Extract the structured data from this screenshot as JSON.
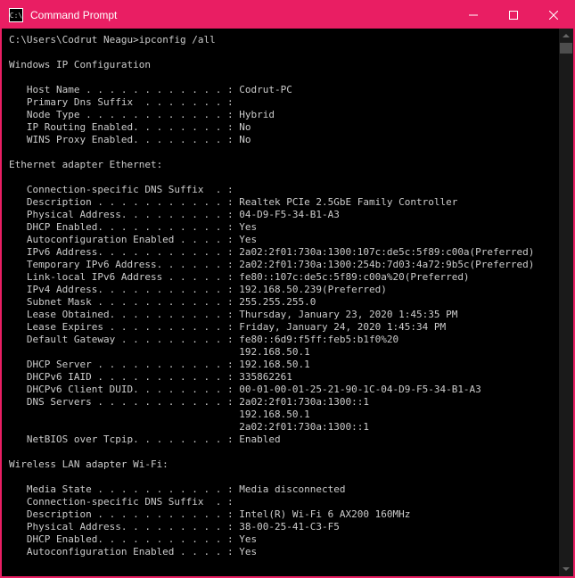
{
  "window": {
    "title": "Command Prompt",
    "icon_text": "C:\\"
  },
  "prompt": {
    "path": "C:\\Users\\Codrut Neagu>",
    "command": "ipconfig /all"
  },
  "sections": {
    "header": "Windows IP Configuration",
    "global": [
      {
        "label": "Host Name . . . . . . . . . . . . :",
        "value": " Codrut-PC"
      },
      {
        "label": "Primary Dns Suffix  . . . . . . . :",
        "value": ""
      },
      {
        "label": "Node Type . . . . . . . . . . . . :",
        "value": " Hybrid"
      },
      {
        "label": "IP Routing Enabled. . . . . . . . :",
        "value": " No"
      },
      {
        "label": "WINS Proxy Enabled. . . . . . . . :",
        "value": " No"
      }
    ],
    "eth_header": "Ethernet adapter Ethernet:",
    "ethernet": [
      {
        "label": "Connection-specific DNS Suffix  . :",
        "value": ""
      },
      {
        "label": "Description . . . . . . . . . . . :",
        "value": " Realtek PCIe 2.5GbE Family Controller"
      },
      {
        "label": "Physical Address. . . . . . . . . :",
        "value": " 04-D9-F5-34-B1-A3"
      },
      {
        "label": "DHCP Enabled. . . . . . . . . . . :",
        "value": " Yes"
      },
      {
        "label": "Autoconfiguration Enabled . . . . :",
        "value": " Yes"
      },
      {
        "label": "IPv6 Address. . . . . . . . . . . :",
        "value": " 2a02:2f01:730a:1300:107c:de5c:5f89:c00a(Preferred)"
      },
      {
        "label": "Temporary IPv6 Address. . . . . . :",
        "value": " 2a02:2f01:730a:1300:254b:7d03:4a72:9b5c(Preferred)"
      },
      {
        "label": "Link-local IPv6 Address . . . . . :",
        "value": " fe80::107c:de5c:5f89:c00a%20(Preferred)"
      },
      {
        "label": "IPv4 Address. . . . . . . . . . . :",
        "value": " 192.168.50.239(Preferred)"
      },
      {
        "label": "Subnet Mask . . . . . . . . . . . :",
        "value": " 255.255.255.0"
      },
      {
        "label": "Lease Obtained. . . . . . . . . . :",
        "value": " Thursday, January 23, 2020 1:45:35 PM"
      },
      {
        "label": "Lease Expires . . . . . . . . . . :",
        "value": " Friday, January 24, 2020 1:45:34 PM"
      },
      {
        "label": "Default Gateway . . . . . . . . . :",
        "value": " fe80::6d9:f5ff:feb5:b1f0%20"
      },
      {
        "label": "                                   ",
        "value": " 192.168.50.1"
      },
      {
        "label": "DHCP Server . . . . . . . . . . . :",
        "value": " 192.168.50.1"
      },
      {
        "label": "DHCPv6 IAID . . . . . . . . . . . :",
        "value": " 335862261"
      },
      {
        "label": "DHCPv6 Client DUID. . . . . . . . :",
        "value": " 00-01-00-01-25-21-90-1C-04-D9-F5-34-B1-A3"
      },
      {
        "label": "DNS Servers . . . . . . . . . . . :",
        "value": " 2a02:2f01:730a:1300::1"
      },
      {
        "label": "                                   ",
        "value": " 192.168.50.1"
      },
      {
        "label": "                                   ",
        "value": " 2a02:2f01:730a:1300::1"
      },
      {
        "label": "NetBIOS over Tcpip. . . . . . . . :",
        "value": " Enabled"
      }
    ],
    "wifi_header": "Wireless LAN adapter Wi-Fi:",
    "wifi": [
      {
        "label": "Media State . . . . . . . . . . . :",
        "value": " Media disconnected"
      },
      {
        "label": "Connection-specific DNS Suffix  . :",
        "value": ""
      },
      {
        "label": "Description . . . . . . . . . . . :",
        "value": " Intel(R) Wi-Fi 6 AX200 160MHz"
      },
      {
        "label": "Physical Address. . . . . . . . . :",
        "value": " 38-00-25-41-C3-F5"
      },
      {
        "label": "DHCP Enabled. . . . . . . . . . . :",
        "value": " Yes"
      },
      {
        "label": "Autoconfiguration Enabled . . . . :",
        "value": " Yes"
      }
    ]
  }
}
